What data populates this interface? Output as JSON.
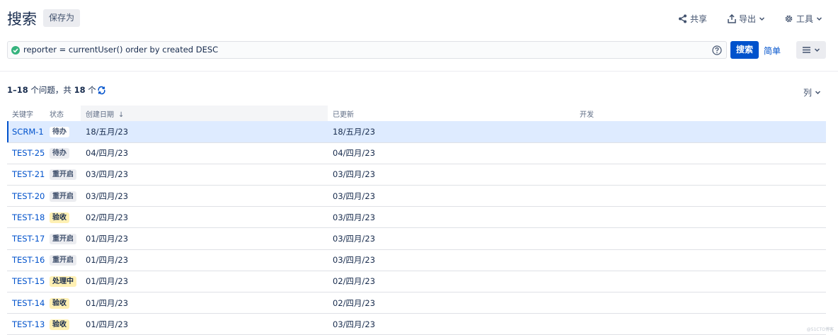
{
  "header": {
    "title": "搜索",
    "save_as": "保存为",
    "share": "共享",
    "export": "导出",
    "tools": "工具"
  },
  "search": {
    "query": "reporter = currentUser() order by created DESC",
    "search_button": "搜索",
    "basic_link": "简单"
  },
  "results": {
    "range": "1–18",
    "middle": " 个问题，共 ",
    "total": "18",
    "suffix": " 个",
    "columns_label": "列"
  },
  "table": {
    "headers": {
      "key": "关键字",
      "status": "状态",
      "created": "创建日期",
      "updated": "已更新",
      "dev": "开发"
    },
    "rows": [
      {
        "key": "SCRM-1",
        "status": "待办",
        "status_kind": "todo",
        "created": "18/五月/23",
        "updated": "18/五月/23"
      },
      {
        "key": "TEST-25",
        "status": "待办",
        "status_kind": "todo",
        "created": "04/四月/23",
        "updated": "04/四月/23"
      },
      {
        "key": "TEST-21",
        "status": "重开启",
        "status_kind": "reopen",
        "created": "03/四月/23",
        "updated": "03/四月/23"
      },
      {
        "key": "TEST-20",
        "status": "重开启",
        "status_kind": "reopen",
        "created": "03/四月/23",
        "updated": "03/四月/23"
      },
      {
        "key": "TEST-18",
        "status": "验收",
        "status_kind": "verify",
        "created": "02/四月/23",
        "updated": "03/四月/23"
      },
      {
        "key": "TEST-17",
        "status": "重开启",
        "status_kind": "reopen",
        "created": "01/四月/23",
        "updated": "03/四月/23"
      },
      {
        "key": "TEST-16",
        "status": "重开启",
        "status_kind": "reopen",
        "created": "01/四月/23",
        "updated": "03/四月/23"
      },
      {
        "key": "TEST-15",
        "status": "处理中",
        "status_kind": "progress",
        "created": "01/四月/23",
        "updated": "02/四月/23"
      },
      {
        "key": "TEST-14",
        "status": "验收",
        "status_kind": "verify",
        "created": "01/四月/23",
        "updated": "02/四月/23"
      },
      {
        "key": "TEST-13",
        "status": "验收",
        "status_kind": "verify",
        "created": "01/四月/23",
        "updated": "03/四月/23"
      }
    ]
  },
  "colors": {
    "accent": "#0052cc",
    "selected_row": "#deebff",
    "success": "#36b37e",
    "inprogress_lozenge": "#fff0b3",
    "default_lozenge": "#ebecf0"
  },
  "watermark": "@51CTO博客"
}
